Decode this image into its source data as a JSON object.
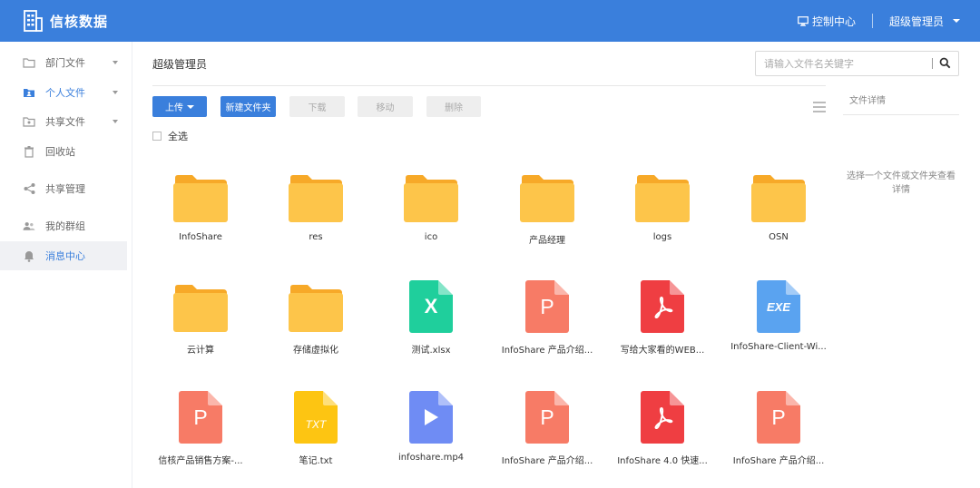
{
  "app": {
    "title": "信核数据"
  },
  "header": {
    "control_center": "控制中心",
    "user": "超级管理员"
  },
  "sidebar": {
    "items": [
      {
        "label": "部门文件",
        "icon": "folder-icon",
        "has_arrow": true
      },
      {
        "label": "个人文件",
        "icon": "user-folder-icon",
        "has_arrow": true
      },
      {
        "label": "共享文件",
        "icon": "shared-folder-icon",
        "has_arrow": true
      },
      {
        "label": "回收站",
        "icon": "trash-icon",
        "has_arrow": false
      },
      {
        "label": "共享管理",
        "icon": "share-icon",
        "has_arrow": false
      },
      {
        "label": "我的群组",
        "icon": "group-icon",
        "has_arrow": false
      },
      {
        "label": "消息中心",
        "icon": "bell-icon",
        "has_arrow": false
      }
    ]
  },
  "main": {
    "title": "超级管理员",
    "search_placeholder": "请输入文件名关键字",
    "toolbar": {
      "upload": "上传",
      "new_folder": "新建文件夹",
      "download": "下载",
      "move": "移动",
      "delete": "删除"
    },
    "select_all": "全选"
  },
  "details": {
    "title": "文件详情",
    "hint": "选择一个文件或文件夹查看详情"
  },
  "files": [
    {
      "name": "InfoShare",
      "type": "folder"
    },
    {
      "name": "res",
      "type": "folder"
    },
    {
      "name": "ico",
      "type": "folder"
    },
    {
      "name": "产品经理",
      "type": "folder"
    },
    {
      "name": "logs",
      "type": "folder"
    },
    {
      "name": "OSN",
      "type": "folder"
    },
    {
      "name": "云计算",
      "type": "folder"
    },
    {
      "name": "存储虚拟化",
      "type": "folder"
    },
    {
      "name": "测试.xlsx",
      "type": "xlsx",
      "glyph": "X"
    },
    {
      "name": "InfoShare 产品介绍...",
      "type": "ppt",
      "glyph": "P"
    },
    {
      "name": "写给大家看的WEB...",
      "type": "pdf"
    },
    {
      "name": "InfoShare-Client-Wi...",
      "type": "exe",
      "glyph": "EXE"
    },
    {
      "name": "信核产品销售方案-...",
      "type": "ppt",
      "glyph": "P"
    },
    {
      "name": "笔记.txt",
      "type": "txt",
      "glyph": "TXT"
    },
    {
      "name": "infoshare.mp4",
      "type": "mp4"
    },
    {
      "name": "InfoShare 产品介绍...",
      "type": "ppt",
      "glyph": "P"
    },
    {
      "name": "InfoShare 4.0 快速...",
      "type": "pdf"
    },
    {
      "name": "InfoShare 产品介绍...",
      "type": "ppt",
      "glyph": "P"
    }
  ],
  "colors": {
    "brand": "#3a7fdc",
    "folder": "#fdc54a",
    "folder_tab": "#f7a928",
    "xlsx": "#1fcf9c",
    "ppt": "#f77b66",
    "pdf": "#ef3e42",
    "exe": "#5aa3f0",
    "txt": "#fdc512",
    "mp4": "#6f8cf4"
  }
}
